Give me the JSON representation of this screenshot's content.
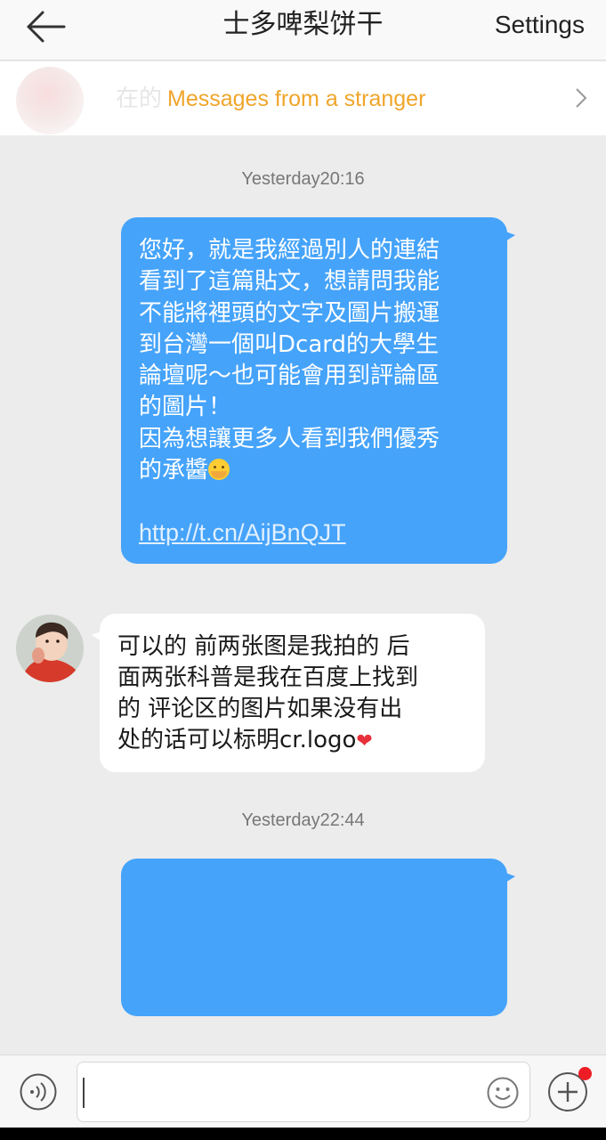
{
  "header": {
    "back_icon": "back-arrow-icon",
    "title": "士多啤梨饼干",
    "settings_label": "Settings"
  },
  "stranger_bar": {
    "ghost_text": "在的",
    "label": "Messages from a stranger",
    "chevron_icon": "chevron-right-icon",
    "label_color": "#f0a52a"
  },
  "messages": [
    {
      "timestamp": "Yesterday20:16",
      "direction": "outgoing",
      "lines": [
        "您好，就是我經過別人的連結",
        "看到了這篇貼文，想請問我能",
        "不能將裡頭的文字及圖片搬運",
        "到台灣一個叫Dcard的大學生",
        "論壇呢～也可能會用到評論區",
        "的圖片！",
        "因為想讓更多人看到我們優秀",
        "的承醬"
      ],
      "emoji_icon": "hugging-face-emoji-icon",
      "link": "http://t.cn/AijBnQJT"
    },
    {
      "direction": "incoming",
      "avatar_icon": "child-avatar",
      "lines": [
        "可以的 前两张图是我拍的 后",
        "面两张科普是我在百度上找到",
        "的 评论区的图片如果没有出",
        "处的话可以标明cr.logo"
      ],
      "emoji_icon": "red-heart-emoji-icon",
      "heart": "❤"
    },
    {
      "timestamp": "Yesterday22:44",
      "direction": "outgoing",
      "lines": []
    }
  ],
  "input_bar": {
    "voice_icon": "voice-icon",
    "text_value": "",
    "emoji_icon": "smiley-icon",
    "plus_icon": "plus-icon",
    "has_notification": true
  },
  "colors": {
    "outgoing_bubble": "#45a3fa",
    "incoming_bubble": "#ffffff",
    "background": "#ececec",
    "accent": "#f0a52a",
    "notification": "#ee1c25"
  }
}
